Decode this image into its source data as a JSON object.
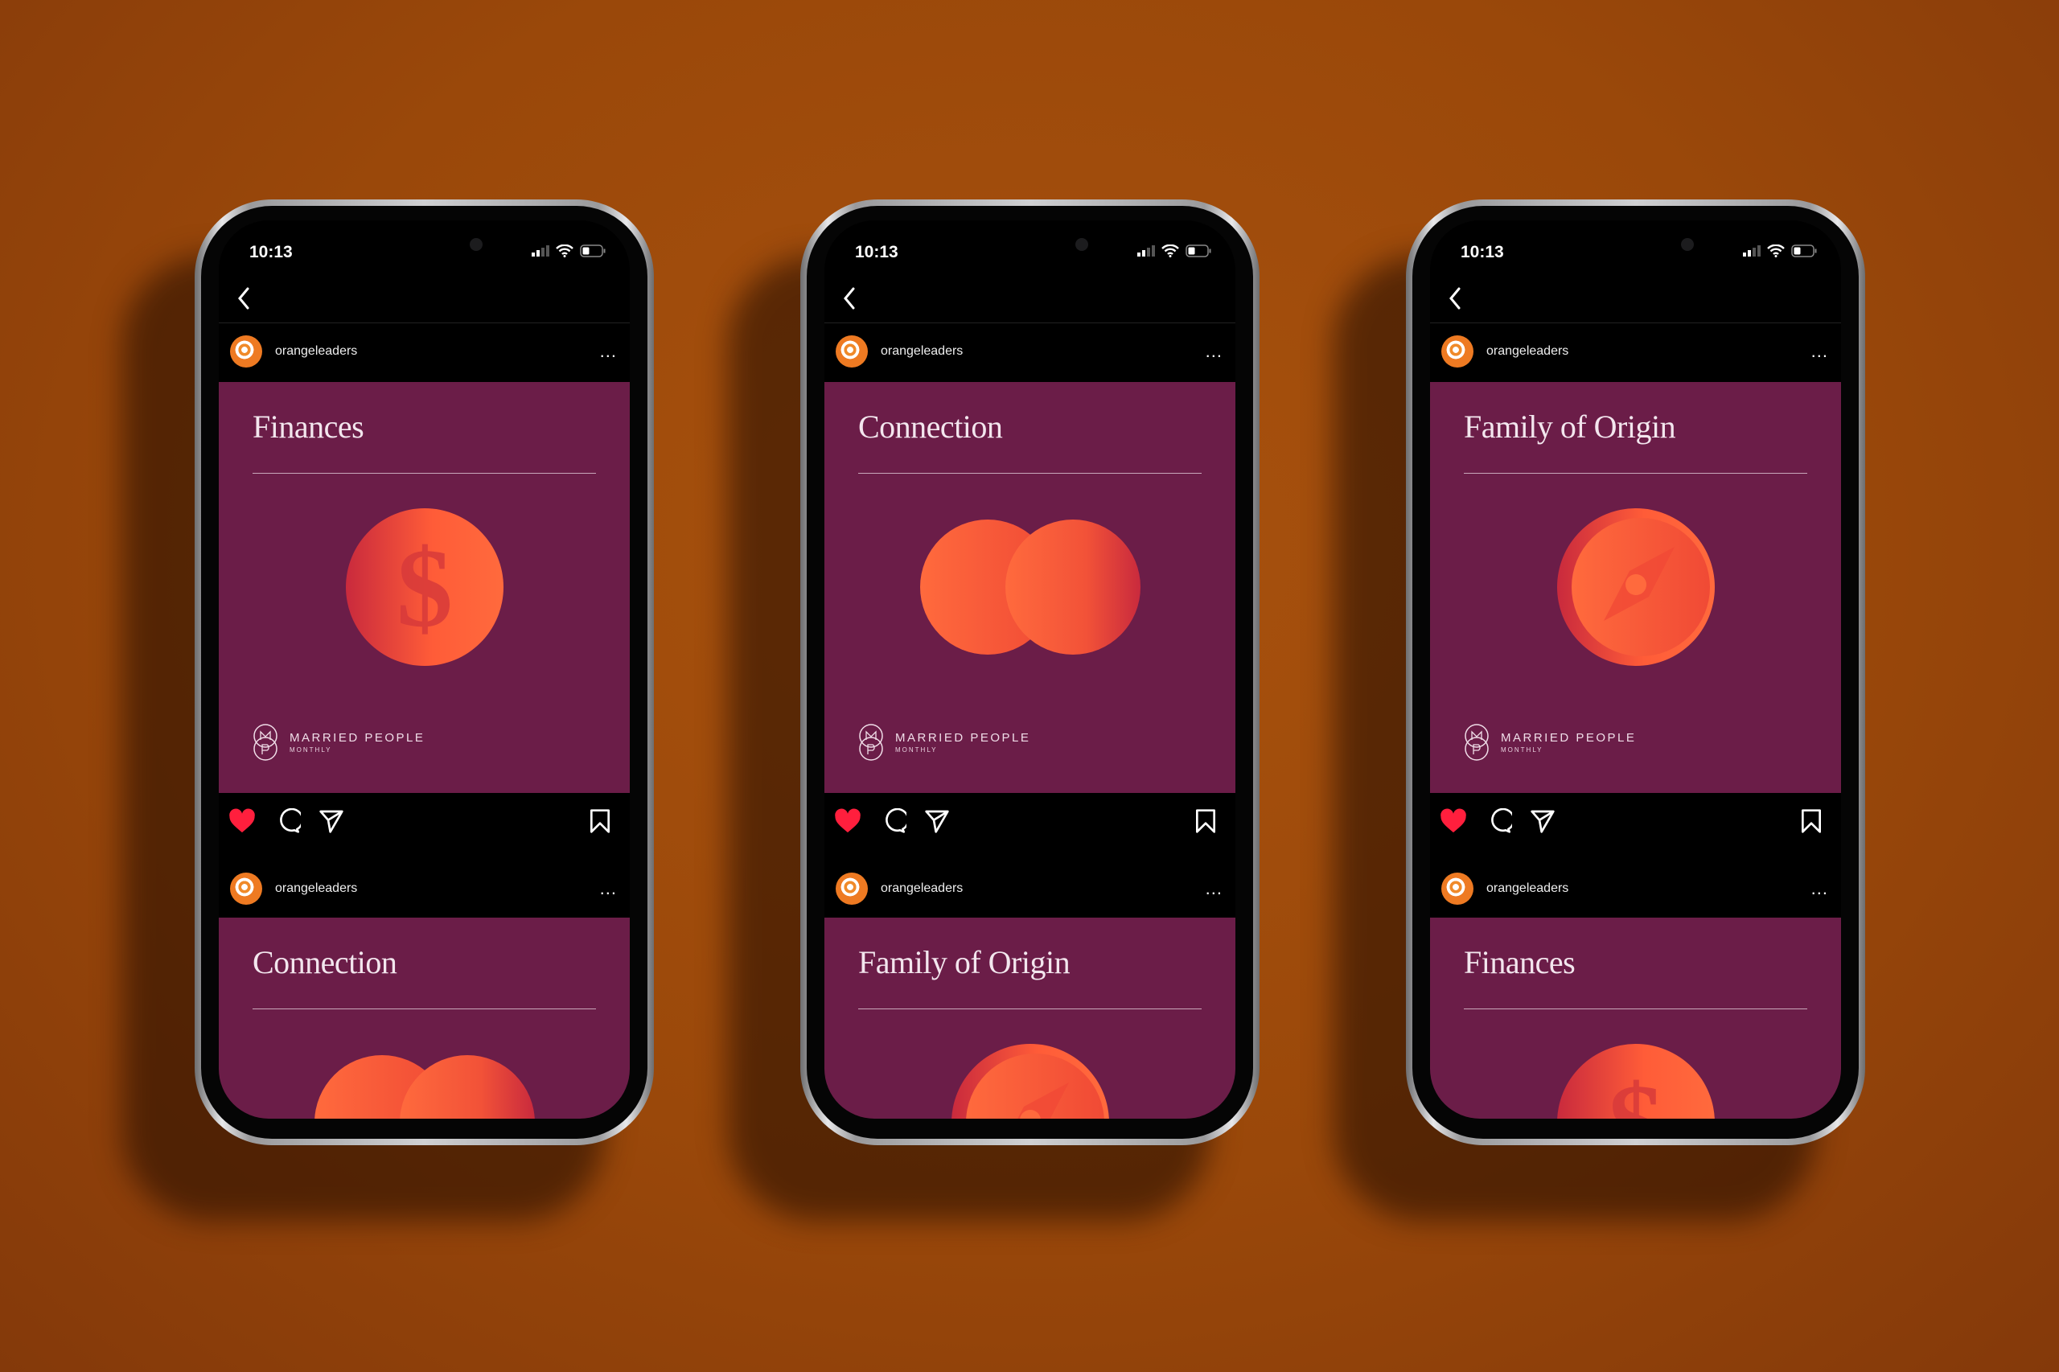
{
  "background_color": "#9a480a",
  "accent": {
    "post_bg": "#6b1d48",
    "icon_orange": "#ff6a3d",
    "icon_red": "#c92a3d",
    "like": "#ff1f3d"
  },
  "phones": [
    {
      "status_time": "10:13",
      "feed": [
        {
          "username": "orangeleaders",
          "more_label": "...",
          "title": "Finances",
          "icon": "dollar-coin-icon",
          "brand": "MARRIED PEOPLE",
          "brand_sub": "MONTHLY"
        },
        {
          "username": "orangeleaders",
          "more_label": "...",
          "title": "Connection",
          "icon": "overlapping-circles-icon"
        }
      ]
    },
    {
      "status_time": "10:13",
      "feed": [
        {
          "username": "orangeleaders",
          "more_label": "...",
          "title": "Connection",
          "icon": "overlapping-circles-icon",
          "brand": "MARRIED PEOPLE",
          "brand_sub": "MONTHLY"
        },
        {
          "username": "orangeleaders",
          "more_label": "...",
          "title": "Family of Origin",
          "icon": "compass-icon"
        }
      ]
    },
    {
      "status_time": "10:13",
      "feed": [
        {
          "username": "orangeleaders",
          "more_label": "...",
          "title": "Family of Origin",
          "icon": "compass-icon",
          "brand": "MARRIED PEOPLE",
          "brand_sub": "MONTHLY"
        },
        {
          "username": "orangeleaders",
          "more_label": "...",
          "title": "Finances",
          "icon": "dollar-coin-icon"
        }
      ]
    }
  ],
  "post_actions": {
    "liked": true,
    "icons": [
      "heart-icon",
      "comment-icon",
      "share-icon",
      "bookmark-icon"
    ]
  }
}
